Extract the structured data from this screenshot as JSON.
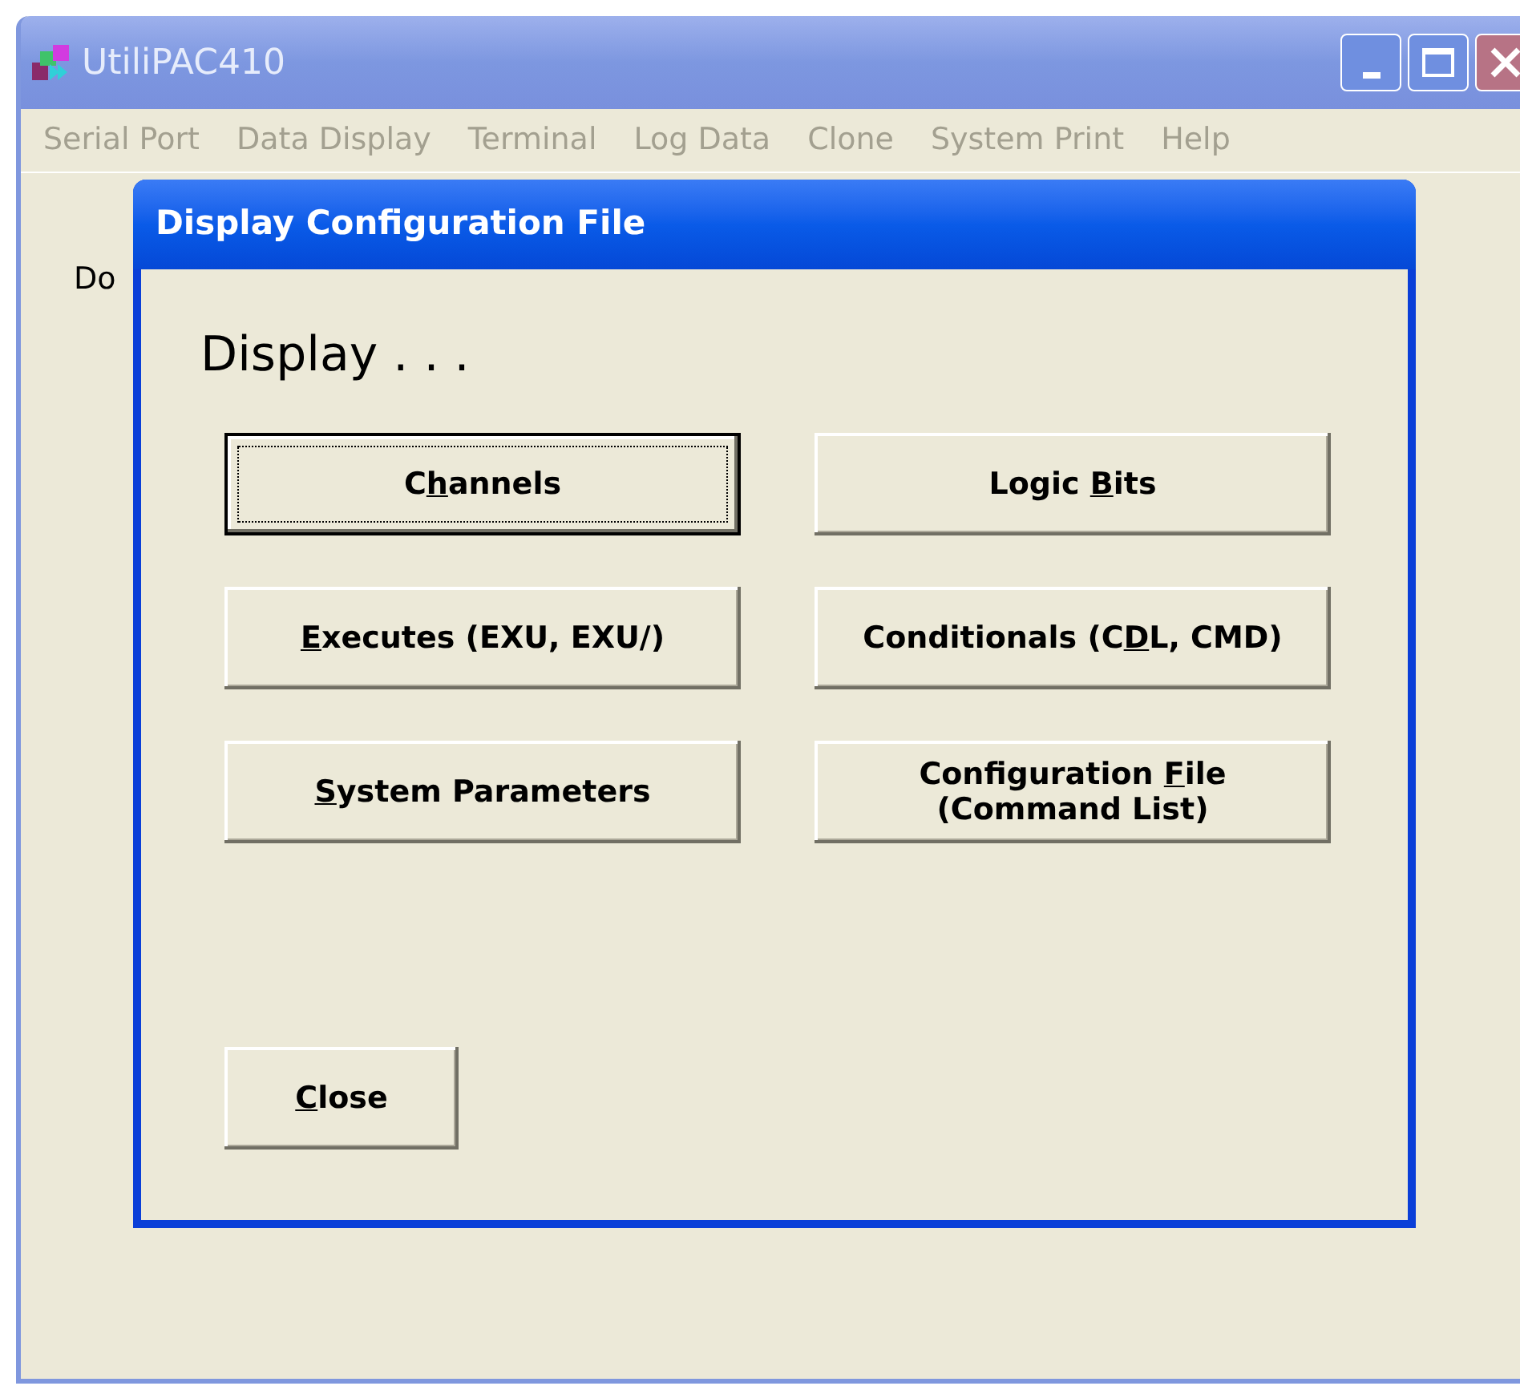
{
  "window": {
    "title": "UtiliPAC410"
  },
  "menu": [
    {
      "label": "Serial Port",
      "disabled": true
    },
    {
      "label": "Data Display",
      "disabled": true
    },
    {
      "label": "Terminal",
      "disabled": true
    },
    {
      "label": "Log Data",
      "disabled": true
    },
    {
      "label": "Clone",
      "disabled": true
    },
    {
      "label": "System Print",
      "disabled": true
    },
    {
      "label": "Help",
      "disabled": true
    }
  ],
  "background_label": "Do",
  "dialog": {
    "title": "Display Configuration File",
    "heading": "Display . . .",
    "buttons": [
      {
        "focused": true,
        "label": [
          {
            "text": "C",
            "underlined": false
          },
          {
            "text": "h",
            "underlined": true
          },
          {
            "text": "annels",
            "underlined": false
          }
        ]
      },
      {
        "focused": false,
        "label": [
          {
            "text": "Logic ",
            "underlined": false
          },
          {
            "text": "B",
            "underlined": true
          },
          {
            "text": "its",
            "underlined": false
          }
        ]
      },
      {
        "focused": false,
        "label": [
          {
            "text": "E",
            "underlined": true
          },
          {
            "text": "xecutes (EXU, EXU/)",
            "underlined": false
          }
        ]
      },
      {
        "focused": false,
        "label": [
          {
            "text": "Conditionals (C",
            "underlined": false
          },
          {
            "text": "D",
            "underlined": true
          },
          {
            "text": "L, CMD)",
            "underlined": false
          }
        ]
      },
      {
        "focused": false,
        "label": [
          {
            "text": "S",
            "underlined": true
          },
          {
            "text": "ystem Parameters",
            "underlined": false
          }
        ]
      },
      {
        "focused": false,
        "label": [
          {
            "text": "Configuration ",
            "underlined": false
          },
          {
            "text": "F",
            "underlined": true
          },
          {
            "text": "ile",
            "underlined": false
          }
        ],
        "line_2": "(Command List)"
      }
    ],
    "close_button": {
      "focused": false,
      "label": [
        {
          "text": "C",
          "underlined": true
        },
        {
          "text": "lose",
          "underlined": false
        }
      ]
    }
  }
}
